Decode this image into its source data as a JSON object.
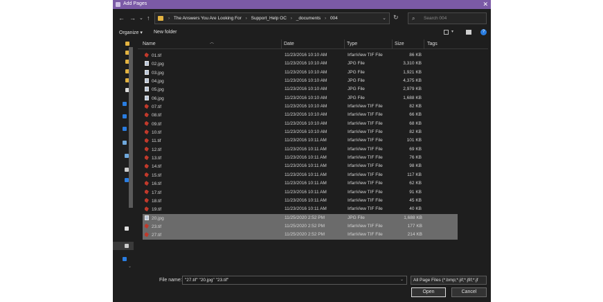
{
  "window": {
    "title": "Add Pages",
    "close_glyph": "✕"
  },
  "nav": {
    "back": "←",
    "forward": "→",
    "dropdown": "⌄",
    "up": "↑",
    "refresh": "↻",
    "address_dropdown": "⌄"
  },
  "breadcrumbs": [
    "The Answers You Are Looking For",
    "Support_Help OC",
    "_documents",
    "004"
  ],
  "search": {
    "placeholder": "Search 004",
    "icon": "⌕"
  },
  "toolbar": {
    "organize": "Organize ▾",
    "new_folder": "New folder",
    "view_dropdown": "▾",
    "help": "?"
  },
  "columns": {
    "name": "Name",
    "date": "Date",
    "type": "Type",
    "size": "Size",
    "tags": "Tags"
  },
  "files": [
    {
      "name": "01.tif",
      "date": "11/23/2016 10:10 AM",
      "type": "IrfanView TIF File",
      "size": "86 KB",
      "kind": "tif"
    },
    {
      "name": "02.jpg",
      "date": "11/23/2016 10:10 AM",
      "type": "JPG File",
      "size": "3,310 KB",
      "kind": "jpg"
    },
    {
      "name": "03.jpg",
      "date": "11/23/2016 10:10 AM",
      "type": "JPG File",
      "size": "1,921 KB",
      "kind": "jpg"
    },
    {
      "name": "04.jpg",
      "date": "11/23/2016 10:10 AM",
      "type": "JPG File",
      "size": "4,375 KB",
      "kind": "jpg"
    },
    {
      "name": "05.jpg",
      "date": "11/23/2016 10:10 AM",
      "type": "JPG File",
      "size": "2,979 KB",
      "kind": "jpg"
    },
    {
      "name": "06.jpg",
      "date": "11/23/2016 10:10 AM",
      "type": "JPG File",
      "size": "1,688 KB",
      "kind": "jpg"
    },
    {
      "name": "07.tif",
      "date": "11/23/2016 10:10 AM",
      "type": "IrfanView TIF File",
      "size": "82 KB",
      "kind": "tif"
    },
    {
      "name": "08.tif",
      "date": "11/23/2016 10:10 AM",
      "type": "IrfanView TIF File",
      "size": "66 KB",
      "kind": "tif"
    },
    {
      "name": "09.tif",
      "date": "11/23/2016 10:10 AM",
      "type": "IrfanView TIF File",
      "size": "68 KB",
      "kind": "tif"
    },
    {
      "name": "10.tif",
      "date": "11/23/2016 10:10 AM",
      "type": "IrfanView TIF File",
      "size": "82 KB",
      "kind": "tif"
    },
    {
      "name": "11.tif",
      "date": "11/23/2016 10:11 AM",
      "type": "IrfanView TIF File",
      "size": "101 KB",
      "kind": "tif"
    },
    {
      "name": "12.tif",
      "date": "11/23/2016 10:11 AM",
      "type": "IrfanView TIF File",
      "size": "69 KB",
      "kind": "tif"
    },
    {
      "name": "13.tif",
      "date": "11/23/2016 10:11 AM",
      "type": "IrfanView TIF File",
      "size": "76 KB",
      "kind": "tif"
    },
    {
      "name": "14.tif",
      "date": "11/23/2016 10:11 AM",
      "type": "IrfanView TIF File",
      "size": "98 KB",
      "kind": "tif"
    },
    {
      "name": "15.tif",
      "date": "11/23/2016 10:11 AM",
      "type": "IrfanView TIF File",
      "size": "117 KB",
      "kind": "tif"
    },
    {
      "name": "16.tif",
      "date": "11/23/2016 10:11 AM",
      "type": "IrfanView TIF File",
      "size": "62 KB",
      "kind": "tif"
    },
    {
      "name": "17.tif",
      "date": "11/23/2016 10:11 AM",
      "type": "IrfanView TIF File",
      "size": "91 KB",
      "kind": "tif"
    },
    {
      "name": "18.tif",
      "date": "11/23/2016 10:11 AM",
      "type": "IrfanView TIF File",
      "size": "45 KB",
      "kind": "tif"
    },
    {
      "name": "19.tif",
      "date": "11/23/2016 10:11 AM",
      "type": "IrfanView TIF File",
      "size": "40 KB",
      "kind": "tif"
    },
    {
      "name": "20.jpg",
      "date": "11/25/2020 2:52 PM",
      "type": "JPG File",
      "size": "1,688 KB",
      "kind": "jpg",
      "selected": true
    },
    {
      "name": "23.tif",
      "date": "11/25/2020 2:52 PM",
      "type": "IrfanView TIF File",
      "size": "177 KB",
      "kind": "tif",
      "selected": true
    },
    {
      "name": "27.tif",
      "date": "11/25/2020 2:52 PM",
      "type": "IrfanView TIF File",
      "size": "214 KB",
      "kind": "tif",
      "selected": true
    }
  ],
  "footer": {
    "file_name_label": "File name:",
    "file_name_value": "\"27.tif\" \"20.jpg\" \"23.tif\"",
    "file_name_dropdown": "⌄",
    "filter": "All Page Files (*.bmp;*.jif;*.jfif;*.jf",
    "open": "Open",
    "cancel": "Cancel"
  },
  "colors": {
    "titlebar": "#7b5aa6",
    "background": "#1e1e1e",
    "selection": "#6b6b6b",
    "tif_icon": "#c0392b",
    "help_icon": "#2a7de1"
  }
}
